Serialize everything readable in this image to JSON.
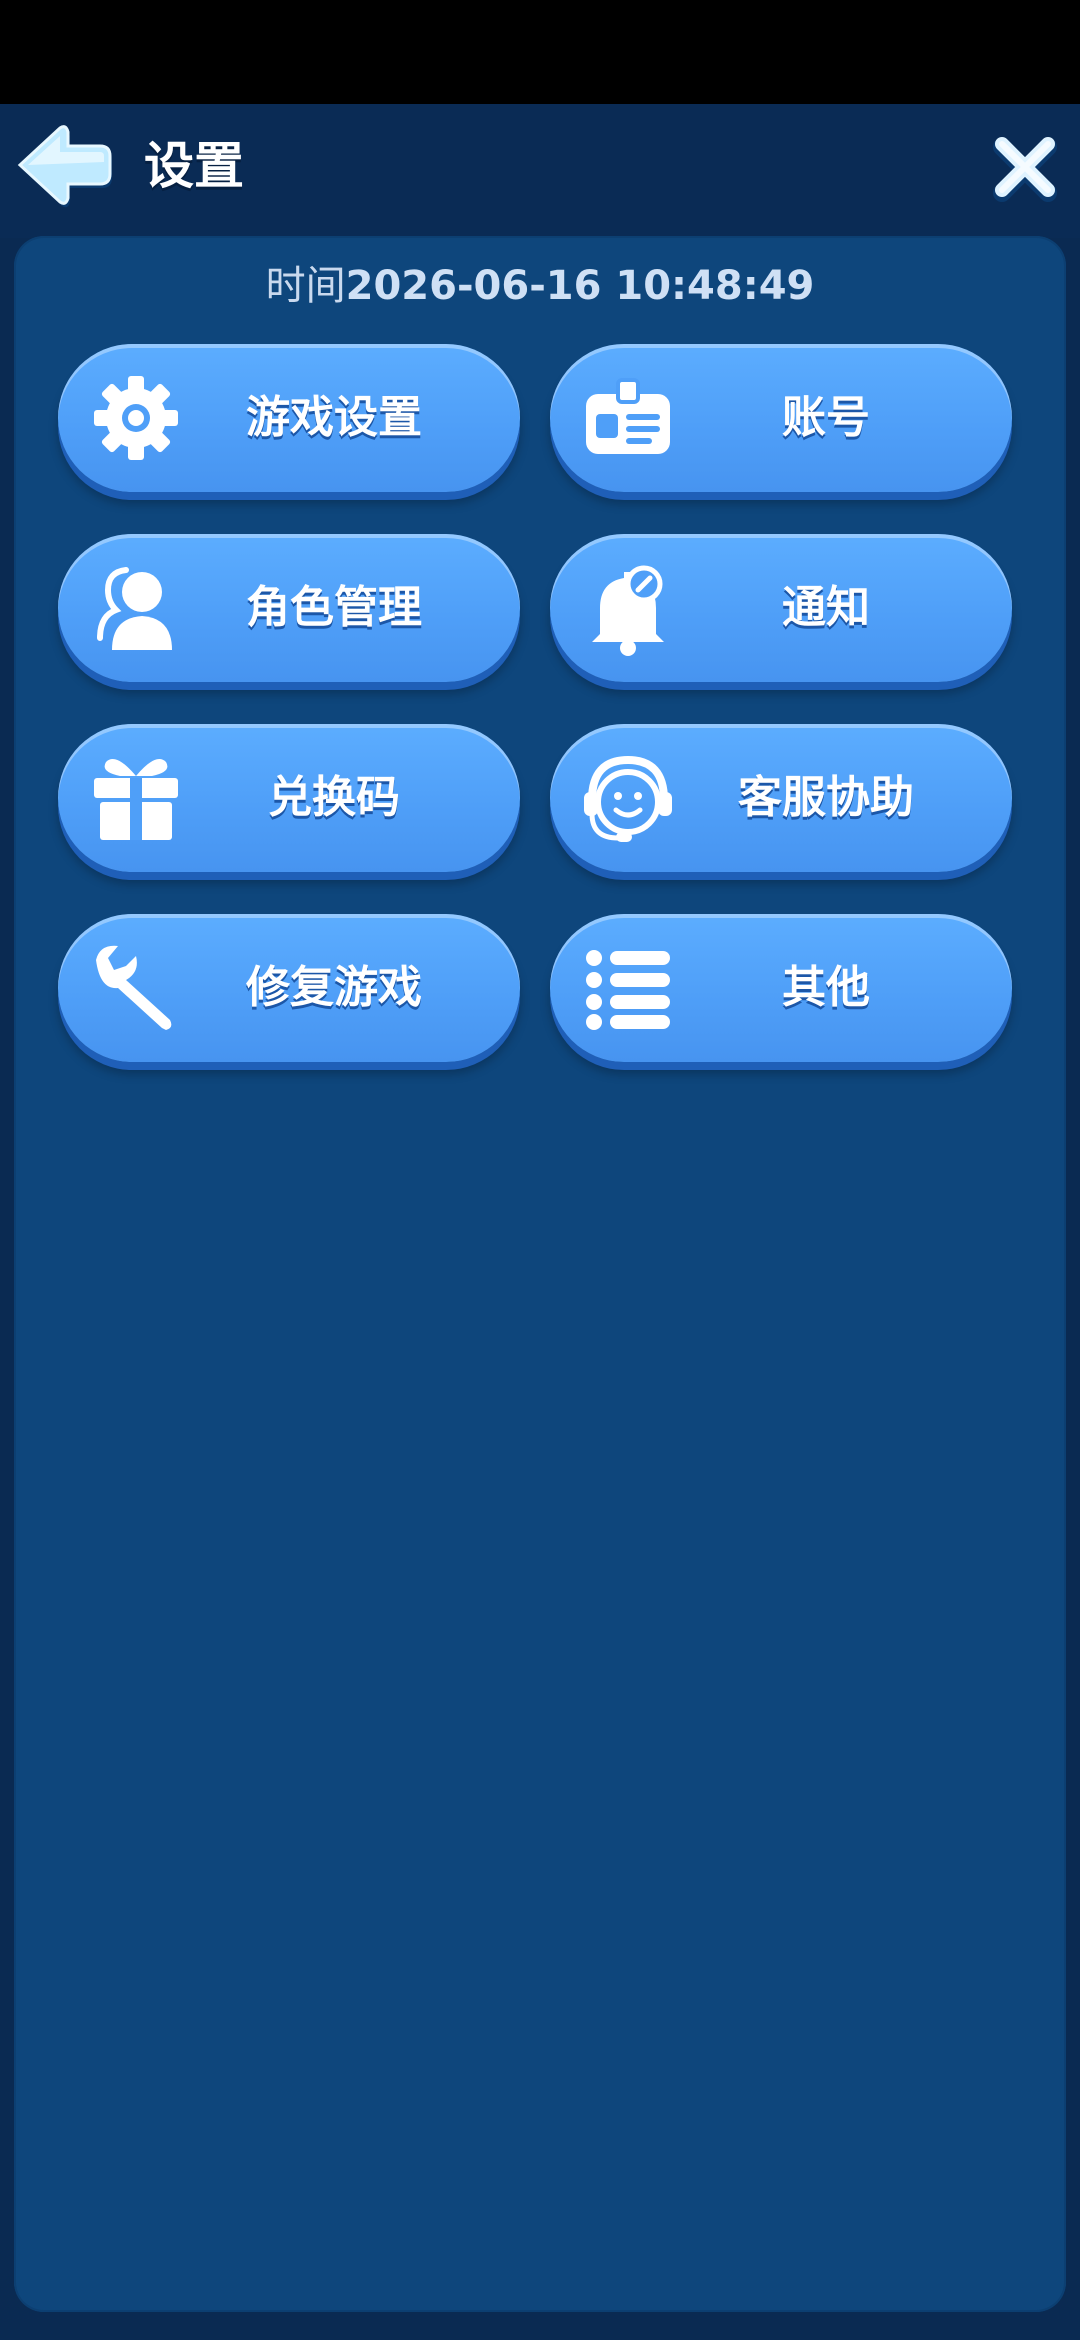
{
  "header": {
    "title": "设置",
    "back_icon": "back-arrow-icon",
    "close_icon": "close-icon"
  },
  "panel": {
    "timestamp_label": "时间",
    "timestamp_value": "2026-06-16 10:48:49"
  },
  "menu": [
    {
      "label": "游戏设置",
      "icon": "gear-icon"
    },
    {
      "label": "账号",
      "icon": "id-card-icon"
    },
    {
      "label": "角色管理",
      "icon": "user-icon"
    },
    {
      "label": "通知",
      "icon": "bell-icon"
    },
    {
      "label": "兑换码",
      "icon": "gift-icon"
    },
    {
      "label": "客服协助",
      "icon": "headset-icon"
    },
    {
      "label": "修复游戏",
      "icon": "wrench-icon"
    },
    {
      "label": "其他",
      "icon": "list-icon"
    }
  ],
  "colors": {
    "background": "#0a2a52",
    "panel": "#0e467c",
    "button": "#4f9ff8",
    "button_shadow": "#1f5fb8",
    "text": "#ffffff"
  }
}
